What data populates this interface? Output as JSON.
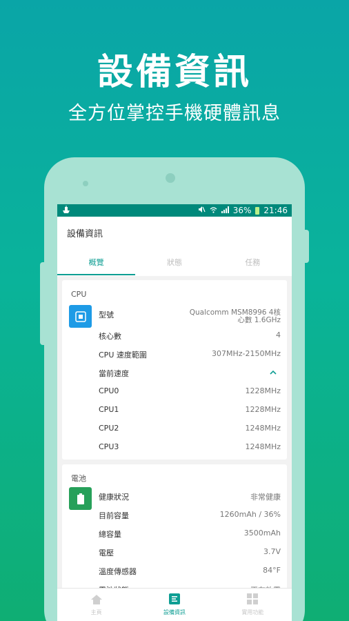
{
  "headline": "設備資訊",
  "subline": "全方位掌控手機硬體訊息",
  "statusbar": {
    "battery": "36%",
    "time": "21:46"
  },
  "appbar": {
    "title": "設備資訊"
  },
  "tabs": [
    "概覽",
    "狀態",
    "任務"
  ],
  "cpu": {
    "title": "CPU",
    "rows": [
      {
        "k": "型號",
        "v1": "Qualcomm MSM8996 4核",
        "v2": "心數 1.6GHz"
      },
      {
        "k": "核心數",
        "v": "4"
      },
      {
        "k": "CPU 速度範圍",
        "v": "307MHz-2150MHz"
      },
      {
        "k": "當前速度",
        "v": ""
      },
      {
        "k": "CPU0",
        "v": "1228MHz"
      },
      {
        "k": "CPU1",
        "v": "1228MHz"
      },
      {
        "k": "CPU2",
        "v": "1248MHz"
      },
      {
        "k": "CPU3",
        "v": "1248MHz"
      }
    ]
  },
  "battery": {
    "title": "電池",
    "rows": [
      {
        "k": "健康狀況",
        "v": "非常健康"
      },
      {
        "k": "目前容量",
        "v": "1260mAh / 36%"
      },
      {
        "k": "總容量",
        "v": "3500mAh"
      },
      {
        "k": "電壓",
        "v": "3.7V"
      },
      {
        "k": "溫度傳感器",
        "v": "84°F"
      },
      {
        "k": "電池狀態",
        "v": "正在放電"
      }
    ]
  },
  "nav": [
    "主頁",
    "設備資訊",
    "實用功能"
  ],
  "colors": {
    "accent": "#0e9e93",
    "cpu_icon": "#1e9be6",
    "battery_icon": "#27a05a"
  }
}
